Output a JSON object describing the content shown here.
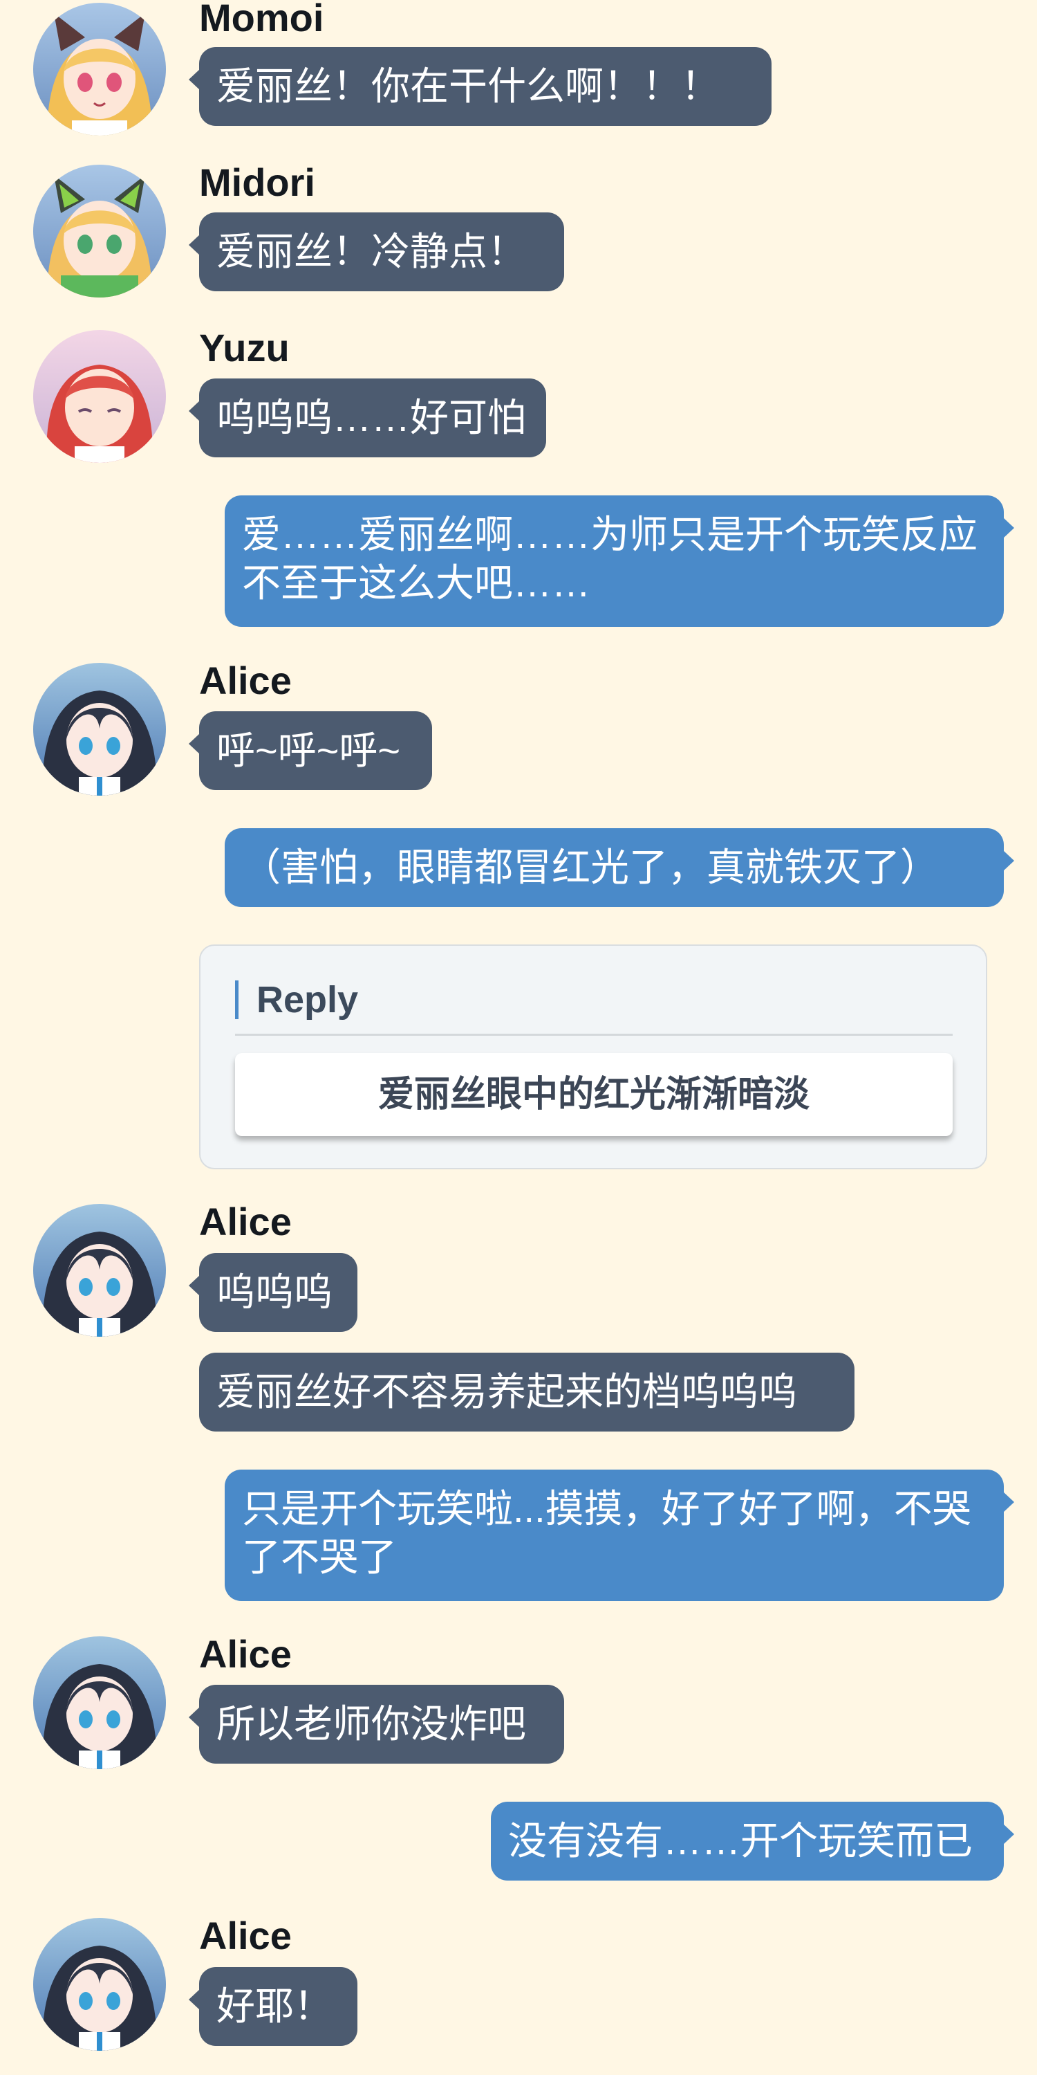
{
  "colors": {
    "background": "#fff7e4",
    "incoming_bubble": "#4c5b70",
    "outgoing_bubble": "#4a8ac9",
    "reply_accent": "#4a8ac9"
  },
  "messages": [
    {
      "sender": "Momoi",
      "avatar": "momoi-avatar",
      "text": "爱丽丝！你在干什么啊！！！"
    },
    {
      "sender": "Midori",
      "avatar": "midori-avatar",
      "text": "爱丽丝！冷静点！"
    },
    {
      "sender": "Yuzu",
      "avatar": "yuzu-avatar",
      "text": "呜呜呜……好可怕"
    },
    {
      "sender": "",
      "text": "爱……爱丽丝啊……为师只是开个玩笑反应不至于这么大吧……"
    },
    {
      "sender": "Alice",
      "avatar": "alice-avatar",
      "text": "呼~呼~呼~"
    },
    {
      "sender": "",
      "text": "（害怕，眼睛都冒红光了，真就铁灭了）"
    },
    {
      "sender": "Alice",
      "avatar": "alice-avatar",
      "text": "呜呜呜"
    },
    {
      "sender": "",
      "text": "爱丽丝好不容易养起来的档呜呜呜"
    },
    {
      "sender": "",
      "text": "只是开个玩笑啦...摸摸，好了好了啊，不哭了不哭了"
    },
    {
      "sender": "Alice",
      "avatar": "alice-avatar",
      "text": "所以老师你没炸吧"
    },
    {
      "sender": "",
      "text": "没有没有……开个玩笑而已"
    },
    {
      "sender": "Alice",
      "avatar": "alice-avatar",
      "text": "好耶！"
    }
  ],
  "reply": {
    "header": "Reply",
    "option": "爱丽丝眼中的红光渐渐暗淡"
  }
}
